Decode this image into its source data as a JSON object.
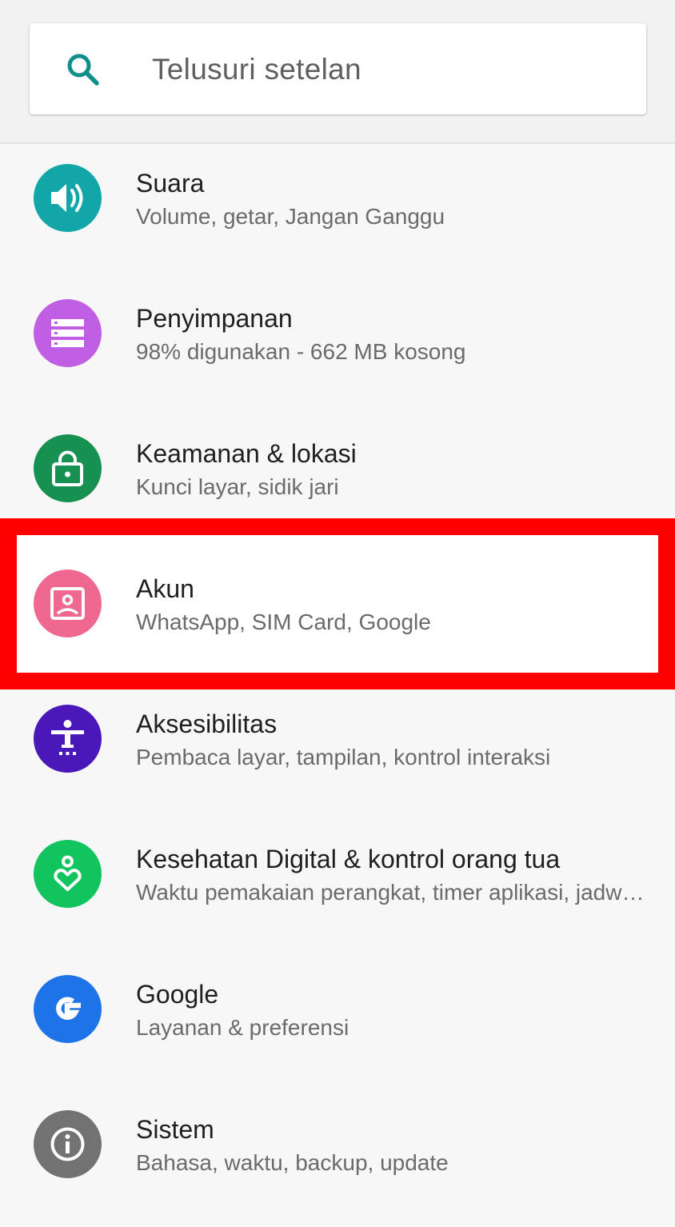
{
  "search": {
    "placeholder": "Telusuri setelan"
  },
  "colors": {
    "highlight": "#ff0000",
    "suara": "#12a6a8",
    "penyimpanan": "#c05ee4",
    "keamanan": "#169152",
    "akun": "#ee6890",
    "aksesibilitas": "#4a18b8",
    "kesehatan": "#12c45e",
    "google": "#1f73e8",
    "sistem": "#727272"
  },
  "items": [
    {
      "title": "Suara",
      "subtitle": "Volume, getar, Jangan Ganggu",
      "icon": "volume-icon"
    },
    {
      "title": "Penyimpanan",
      "subtitle": "98% digunakan - 662 MB kosong",
      "icon": "storage-icon"
    },
    {
      "title": "Keamanan & lokasi",
      "subtitle": "Kunci layar, sidik jari",
      "icon": "lock-icon"
    },
    {
      "title": "Akun",
      "subtitle": "WhatsApp, SIM Card, Google",
      "icon": "account-icon"
    },
    {
      "title": "Aksesibilitas",
      "subtitle": "Pembaca layar, tampilan, kontrol interaksi",
      "icon": "accessibility-icon"
    },
    {
      "title": "Kesehatan Digital & kontrol orang tua",
      "subtitle": "Waktu pemakaian perangkat, timer aplikasi, jadw…",
      "icon": "digital-wellbeing-icon"
    },
    {
      "title": "Google",
      "subtitle": "Layanan & preferensi",
      "icon": "google-icon"
    },
    {
      "title": "Sistem",
      "subtitle": "Bahasa, waktu, backup, update",
      "icon": "info-icon"
    }
  ]
}
